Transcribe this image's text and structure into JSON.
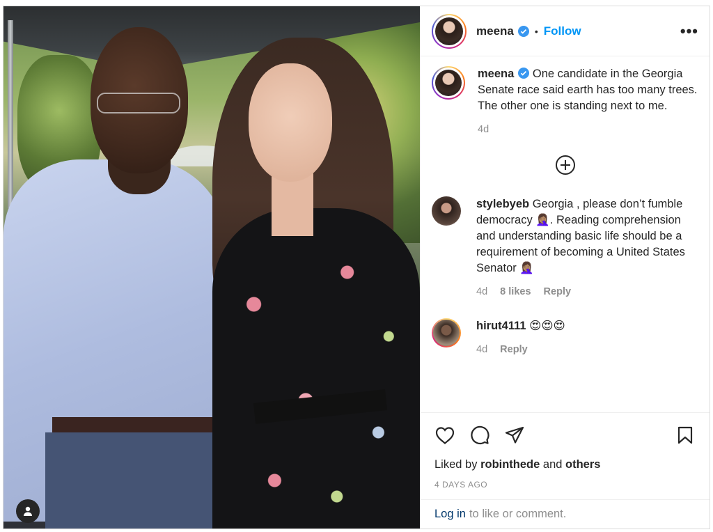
{
  "post": {
    "author": "meena",
    "follow_label": "Follow",
    "separator": "•",
    "more_label": "•••"
  },
  "caption": {
    "username": "meena",
    "text": "One candidate in the Georgia Senate race said earth has too many trees. The other one is standing next to me.",
    "time": "4d"
  },
  "comments": [
    {
      "username": "stylebyeb",
      "text": "Georgia , please don’t fumble democracy 🤦🏽‍♀️. Reading comprehension and understanding basic life should be a requirement of becoming a United States Senator 🤦🏽‍♀️",
      "time": "4d",
      "likes": "8 likes",
      "reply": "Reply"
    },
    {
      "username": "hirut4111",
      "text": "😍😍😍",
      "time": "4d",
      "reply": "Reply"
    }
  ],
  "likes": {
    "prefix": "Liked by",
    "user": "robinthede",
    "and": "and",
    "others": "others"
  },
  "posted_ago": "4 DAYS AGO",
  "login": {
    "link": "Log in",
    "rest": "to like or comment."
  },
  "colors": {
    "accent": "#0095f6",
    "verified": "#3897f0",
    "muted": "#8e8e8e"
  },
  "icons": [
    "user-tag-icon",
    "verified-icon",
    "more-icon",
    "load-more-icon",
    "heart-icon",
    "comment-icon",
    "share-icon",
    "bookmark-icon"
  ]
}
